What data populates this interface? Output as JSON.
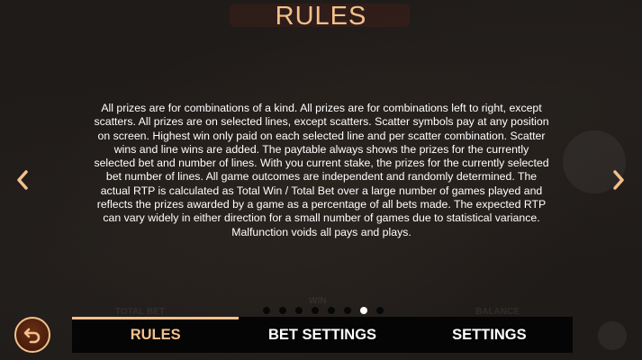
{
  "title": "RULES",
  "rules_text": "All prizes are for combinations of a kind. All prizes are for combinations left to right, except scatters. All prizes are on selected lines, except scatters. Scatter symbols pay at any position on screen. Highest win only paid on each selected line and per scatter combination. Scatter wins and line wins are added. The paytable always shows the prizes for the currently selected bet and number of lines. With you current stake, the prizes for the currently selected bet number of lines. All game outcomes are independent and randomly determined. The actual RTP is calculated as Total Win / Total Bet over a large number of games played and reflects the prizes awarded by a game as a percentage of all bets made. The expected RTP can vary widely in either direction for a small number of games due to statistical variance. Malfunction voids all pays and plays.",
  "pagination": {
    "total_pages": 8,
    "current_page": 7
  },
  "background_labels": {
    "total_bet": "TOTAL BET",
    "win": "WIN",
    "balance": "BALANCE"
  },
  "tabs": [
    {
      "label": "RULES",
      "active": true
    },
    {
      "label": "BET SETTINGS",
      "active": false
    },
    {
      "label": "SETTINGS",
      "active": false
    }
  ],
  "icons": {
    "prev": "chevron-left-icon",
    "next": "chevron-right-icon",
    "back": "undo-arrow-icon"
  },
  "colors": {
    "accent": "#f3c18c",
    "tabbar": "#050505",
    "back_button": "#5a2410"
  }
}
